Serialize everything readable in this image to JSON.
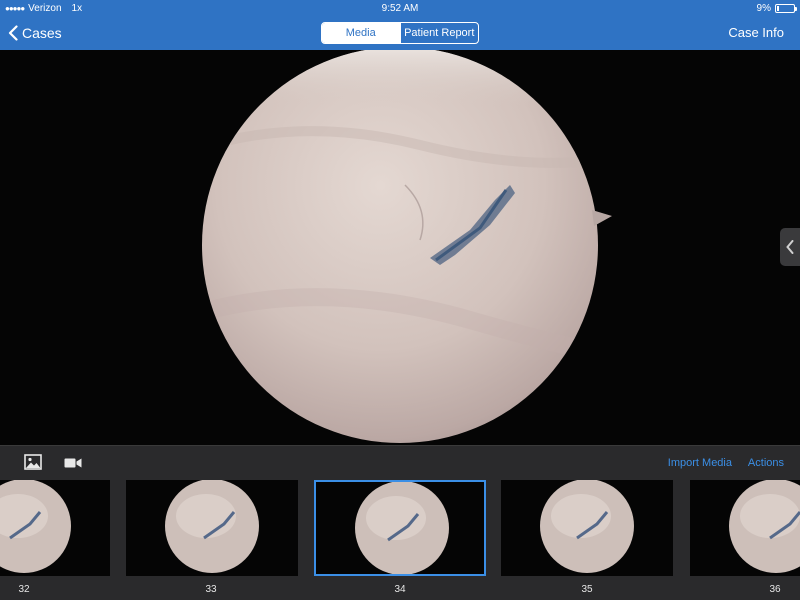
{
  "status_bar": {
    "carrier": "Verizon",
    "network": "1x",
    "time": "9:52 AM",
    "battery_percent": "9%",
    "battery_level": 0.09
  },
  "nav": {
    "back_label": "Cases",
    "segments": [
      {
        "label": "Media",
        "active": true
      },
      {
        "label": "Patient Report",
        "active": false
      }
    ],
    "right_label": "Case Info"
  },
  "media_toolbar": {
    "photo_icon": "photo-icon",
    "video_icon": "video-camera-icon",
    "import_label": "Import Media",
    "actions_label": "Actions"
  },
  "thumbnails": [
    {
      "label": "32",
      "selected": false
    },
    {
      "label": "33",
      "selected": false
    },
    {
      "label": "34",
      "selected": true
    },
    {
      "label": "35",
      "selected": false
    },
    {
      "label": "36",
      "selected": false
    }
  ],
  "colors": {
    "nav_blue": "#2f73c4",
    "link_blue": "#3b8fe6",
    "toolbar_bg": "#2a2a2c"
  }
}
